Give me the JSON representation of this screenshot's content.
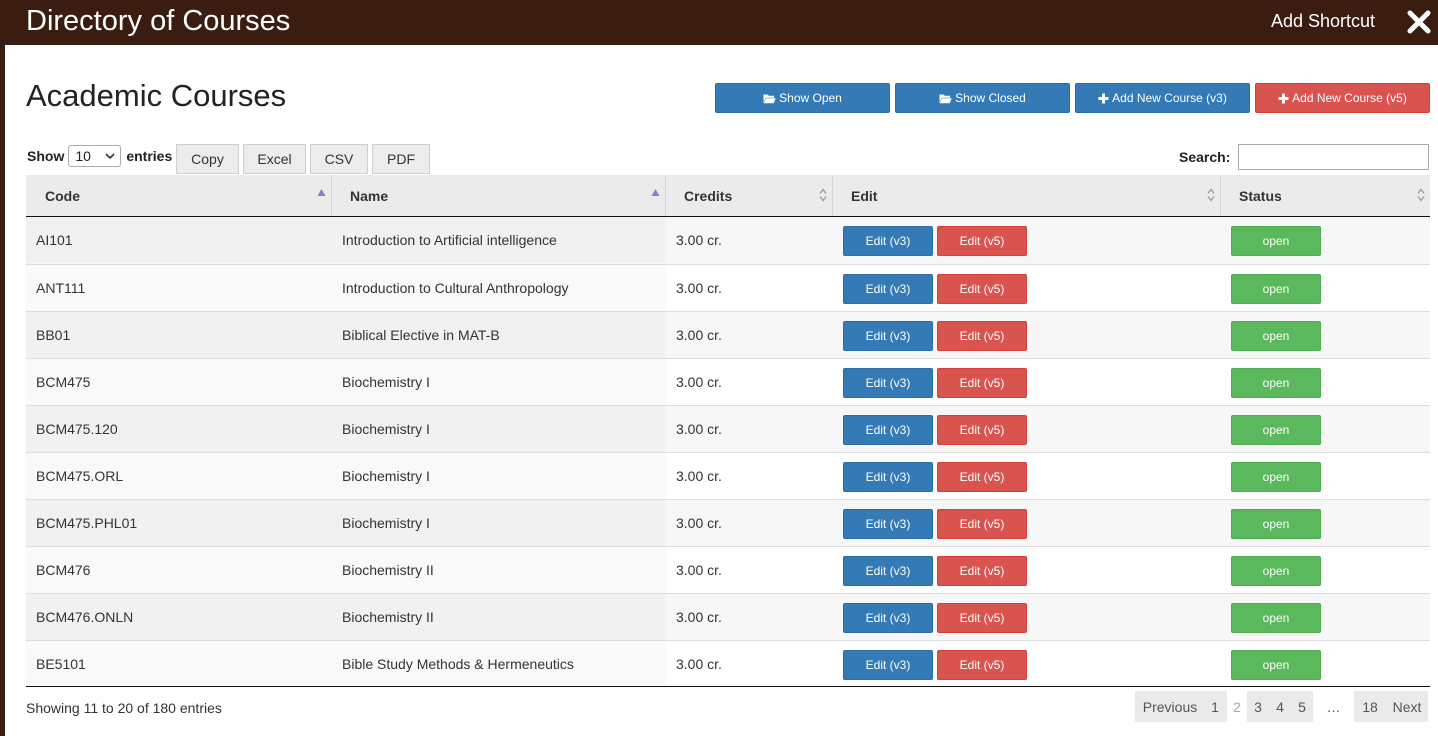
{
  "window": {
    "title": "Directory of Courses",
    "add_shortcut_label": "Add Shortcut",
    "close_icon": "close-icon"
  },
  "page": {
    "heading": "Academic Courses"
  },
  "toolbar": {
    "show_open_label": "Show Open",
    "show_closed_label": "Show Closed",
    "add_course_v3_label": "Add New Course (v3)",
    "add_course_v5_label": "Add New Course (v5)",
    "folder_icon": "folder-open-icon",
    "plus_icon": "plus-icon",
    "colors": {
      "primary": "#337ab7",
      "danger": "#d9534f",
      "success": "#5cb85c",
      "titlebar": "#3a1c11"
    }
  },
  "length_control": {
    "show_label": "Show",
    "selected_value": "10",
    "entries_label": "entries"
  },
  "export_buttons": [
    "Copy",
    "Excel",
    "CSV",
    "PDF"
  ],
  "search": {
    "label": "Search:",
    "value": ""
  },
  "table": {
    "columns": [
      "Code",
      "Name",
      "Credits",
      "Edit",
      "Status"
    ],
    "edit_v3_label": "Edit (v3)",
    "edit_v5_label": "Edit (v5)",
    "rows": [
      {
        "code": "AI101",
        "name": "Introduction to Artificial intelligence",
        "credits": "3.00 cr.",
        "status": "open"
      },
      {
        "code": "ANT111",
        "name": "Introduction to Cultural Anthropology",
        "credits": "3.00 cr.",
        "status": "open"
      },
      {
        "code": "BB01",
        "name": "Biblical Elective in MAT-B",
        "credits": "3.00 cr.",
        "status": "open"
      },
      {
        "code": "BCM475",
        "name": "Biochemistry I",
        "credits": "3.00 cr.",
        "status": "open"
      },
      {
        "code": "BCM475.120",
        "name": "Biochemistry I",
        "credits": "3.00 cr.",
        "status": "open"
      },
      {
        "code": "BCM475.ORL",
        "name": "Biochemistry I",
        "credits": "3.00 cr.",
        "status": "open"
      },
      {
        "code": "BCM475.PHL01",
        "name": "Biochemistry I",
        "credits": "3.00 cr.",
        "status": "open"
      },
      {
        "code": "BCM476",
        "name": "Biochemistry II",
        "credits": "3.00 cr.",
        "status": "open"
      },
      {
        "code": "BCM476.ONLN",
        "name": "Biochemistry II",
        "credits": "3.00 cr.",
        "status": "open"
      },
      {
        "code": "BE5101",
        "name": "Bible Study Methods & Hermeneutics",
        "credits": "3.00 cr.",
        "status": "open"
      }
    ]
  },
  "footer": {
    "info": "Showing 11 to 20 of 180 entries"
  },
  "pagination": {
    "previous": "Previous",
    "next": "Next",
    "pages": [
      "1",
      "2",
      "3",
      "4",
      "5",
      "…",
      "18"
    ],
    "current": "2"
  }
}
